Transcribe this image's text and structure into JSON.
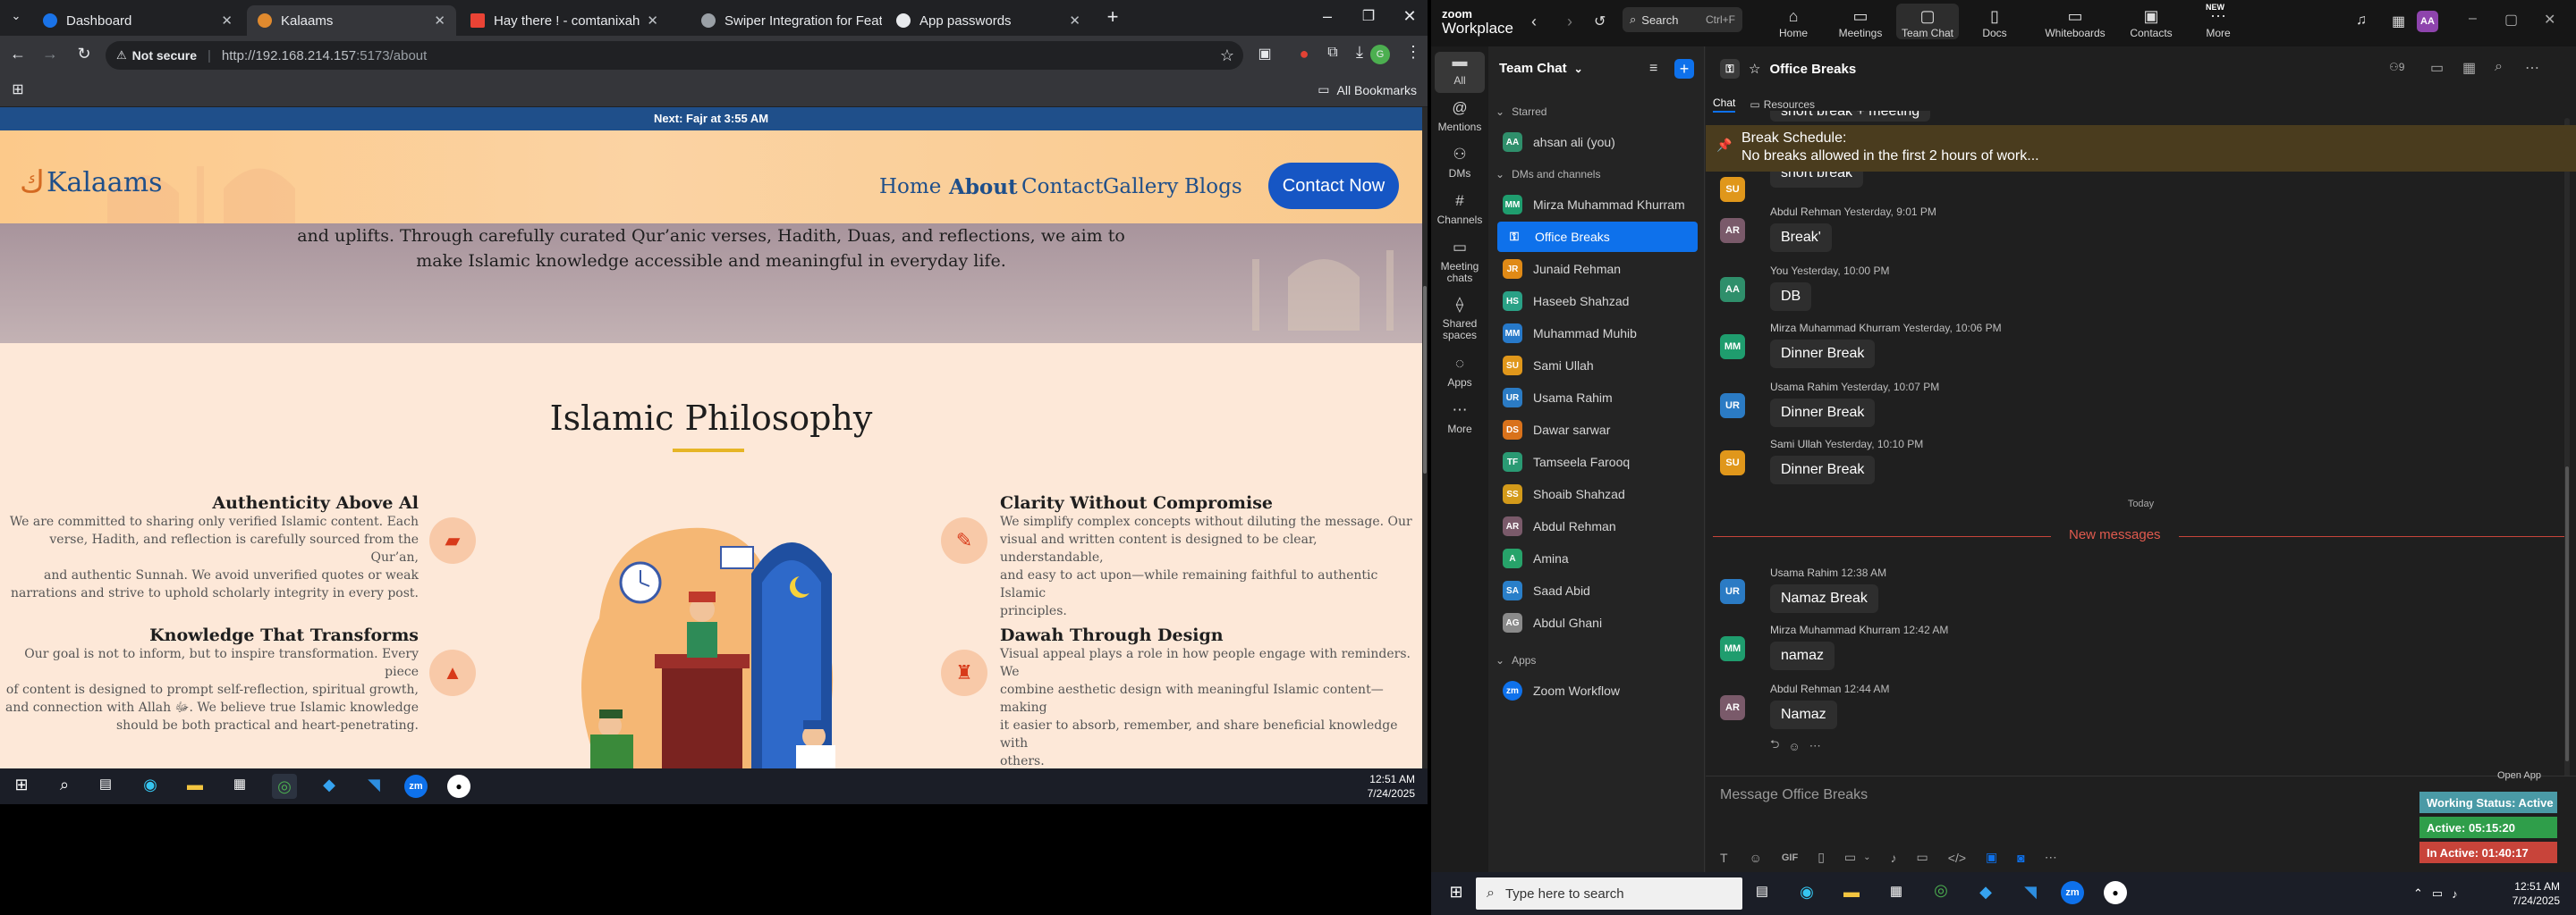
{
  "browser": {
    "tabs": [
      {
        "title": "Dashboard",
        "favicon_color": "#1a73e8"
      },
      {
        "title": "Kalaams",
        "favicon_color": "#e08a2e",
        "active": true
      },
      {
        "title": "Hay there ! - comtanixahsan@",
        "favicon_color": "#ea4335"
      },
      {
        "title": "Swiper Integration for Features",
        "favicon_color": "#9aa0a6"
      },
      {
        "title": "App passwords",
        "favicon_color": "#e8eaed"
      }
    ],
    "new_tab": "+",
    "security_label": "Not secure",
    "url_host": "http://192.168.214.157",
    "url_path": ":5173/about",
    "all_bookmarks": "All Bookmarks"
  },
  "site": {
    "prayer_bar": "Next: Fajr at 3:55 AM",
    "logo_text": "Kalaams",
    "nav": [
      "Home",
      "About",
      "Contact",
      "Gallery",
      "Blogs"
    ],
    "active_nav": "About",
    "cta": "Contact Now",
    "hero_lines": [
      "and uplifts. Through carefully curated Qur’anic verses, Hadith, Duas, and reflections, we aim to",
      "make Islamic knowledge accessible and meaningful in everyday life."
    ],
    "section_title": "Islamic Philosophy",
    "features": [
      {
        "title": "Authenticity Above Al",
        "text": [
          "We are committed to sharing only verified Islamic content. Each",
          "verse, Hadith, and reflection is carefully sourced from the Qur’an,",
          "and authentic Sunnah. We avoid unverified quotes or weak",
          "narrations and strive to uphold scholarly integrity in every post."
        ],
        "icon": "book-icon"
      },
      {
        "title": "Knowledge That Transforms",
        "text": [
          "Our goal is not to inform, but to inspire transformation. Every piece",
          "of content is designed to prompt self-reflection, spiritual growth,",
          "and connection with Allah ﷻ. We believe true Islamic knowledge",
          "should be both practical and heart-penetrating."
        ],
        "icon": "graduation-cap-icon"
      },
      {
        "title": "Clarity Without Compromise",
        "text": [
          "We simplify complex concepts without diluting the message. Our",
          "visual and written content is designed to be clear, understandable,",
          "and easy to act upon—while remaining faithful to authentic Islamic",
          "principles."
        ],
        "icon": "reading-person-icon"
      },
      {
        "title": "Dawah Through Design",
        "text": [
          "Visual appeal plays a role in how people engage with reminders. We",
          "combine aesthetic design with meaningful Islamic content—making",
          "it easier to absorb, remember, and share beneficial knowledge with",
          "others."
        ],
        "icon": "teacher-icon"
      }
    ]
  },
  "taskbar_left": {
    "time": "12:51 AM",
    "date": "7/24/2025"
  },
  "zoom": {
    "brand_top": "zoom",
    "brand_bottom": "Workplace",
    "search_label": "Search",
    "search_shortcut": "Ctrl+F",
    "top_tabs": [
      "Home",
      "Meetings",
      "Team Chat",
      "Docs",
      "Whiteboards",
      "Contacts",
      "More"
    ],
    "new_badge": "NEW",
    "user_initials": "AA",
    "rail": [
      "All",
      "Mentions",
      "DMs",
      "Channels",
      "Meeting chats",
      "Shared spaces",
      "Apps",
      "More"
    ],
    "list_title": "Team Chat",
    "starred_label": "Starred",
    "dms_label": "DMs and channels",
    "apps_label": "Apps",
    "starred": [
      {
        "name": "ahsan ali (you)",
        "initials": "AA",
        "color": "#2f8f6b"
      }
    ],
    "channels": [
      {
        "name": "Mirza Muhammad Khurram",
        "initials": "MM",
        "color": "#1f9d6e"
      },
      {
        "name": "Office Breaks",
        "initials": "",
        "color": "#0e71eb",
        "selected": true
      },
      {
        "name": "Junaid Rehman",
        "initials": "JR",
        "color": "#e08a16"
      },
      {
        "name": "Haseeb Shahzad",
        "initials": "HS",
        "color": "#2aa186"
      },
      {
        "name": "Muhammad Muhib",
        "initials": "MM",
        "color": "#2779c9"
      },
      {
        "name": "Sami Ullah",
        "initials": "SU",
        "color": "#e0971b"
      },
      {
        "name": "Usama Rahim",
        "initials": "UR",
        "color": "#2b7bc4"
      },
      {
        "name": "Dawar sarwar",
        "initials": "DS",
        "color": "#d9721b"
      },
      {
        "name": "Tamseela Farooq",
        "initials": "TF",
        "color": "#2a9a73"
      },
      {
        "name": "Shoaib Shahzad",
        "initials": "SS",
        "color": "#d39a1a"
      },
      {
        "name": "Abdul Rehman",
        "initials": "AR",
        "color": "#7a5a6a"
      },
      {
        "name": "Amina",
        "initials": "A",
        "color": "#27a36a"
      },
      {
        "name": "Saad Abid",
        "initials": "SA",
        "color": "#2a7fc9"
      },
      {
        "name": "Abdul Ghani",
        "initials": "AG",
        "color": "#8a8a8a"
      }
    ],
    "apps": [
      {
        "name": "Zoom Workflow",
        "initials": "zm",
        "color": "#0e71eb"
      }
    ],
    "chat_title": "Office Breaks",
    "member_count": "9",
    "chat_tabs": [
      "Chat",
      "Resources"
    ],
    "pinned_title": "Break Schedule:",
    "pinned_text": "No breaks allowed in the first 2 hours of work...",
    "partial_top": "short break + meeting",
    "messages": [
      {
        "initials": "SU",
        "color": "#e0971b",
        "name": "",
        "time": "",
        "text": "short break"
      },
      {
        "initials": "AR",
        "color": "#7a5a6a",
        "name": "Abdul Rehman",
        "time": "Yesterday, 9:01 PM",
        "text": "Break'"
      },
      {
        "initials": "AA",
        "color": "#2f8f6b",
        "name": "You",
        "time": "Yesterday, 10:00 PM",
        "text": "DB"
      },
      {
        "initials": "MM",
        "color": "#1f9d6e",
        "name": "Mirza Muhammad Khurram",
        "time": "Yesterday, 10:06 PM",
        "text": "Dinner Break"
      },
      {
        "initials": "UR",
        "color": "#2b7bc4",
        "name": "Usama Rahim",
        "time": "Yesterday, 10:07 PM",
        "text": "Dinner Break"
      },
      {
        "initials": "SU",
        "color": "#e0971b",
        "name": "Sami Ullah",
        "time": "Yesterday, 10:10 PM",
        "text": "Dinner Break"
      },
      {
        "initials": "UR",
        "color": "#2b7bc4",
        "name": "Usama Rahim",
        "time": "12:38 AM",
        "text": "Namaz Break"
      },
      {
        "initials": "MM",
        "color": "#1f9d6e",
        "name": "Mirza Muhammad Khurram",
        "time": "12:42 AM",
        "text": "namaz"
      },
      {
        "initials": "AR",
        "color": "#7a5a6a",
        "name": "Abdul Rehman",
        "time": "12:44 AM",
        "text": "Namaz"
      }
    ],
    "today_label": "Today",
    "new_messages": "New messages",
    "compose_placeholder": "Message Office Breaks",
    "open_app": "Open App",
    "status": [
      {
        "text": "Working Status: Active",
        "color": "#4a9aa6"
      },
      {
        "text": "Active: 05:15:20",
        "color": "#2f9e4a"
      },
      {
        "text": "In Active: 01:40:17",
        "color": "#c8443a"
      }
    ]
  },
  "taskbar_right": {
    "search_placeholder": "Type here to search",
    "time": "12:51 AM",
    "date": "7/24/2025"
  }
}
